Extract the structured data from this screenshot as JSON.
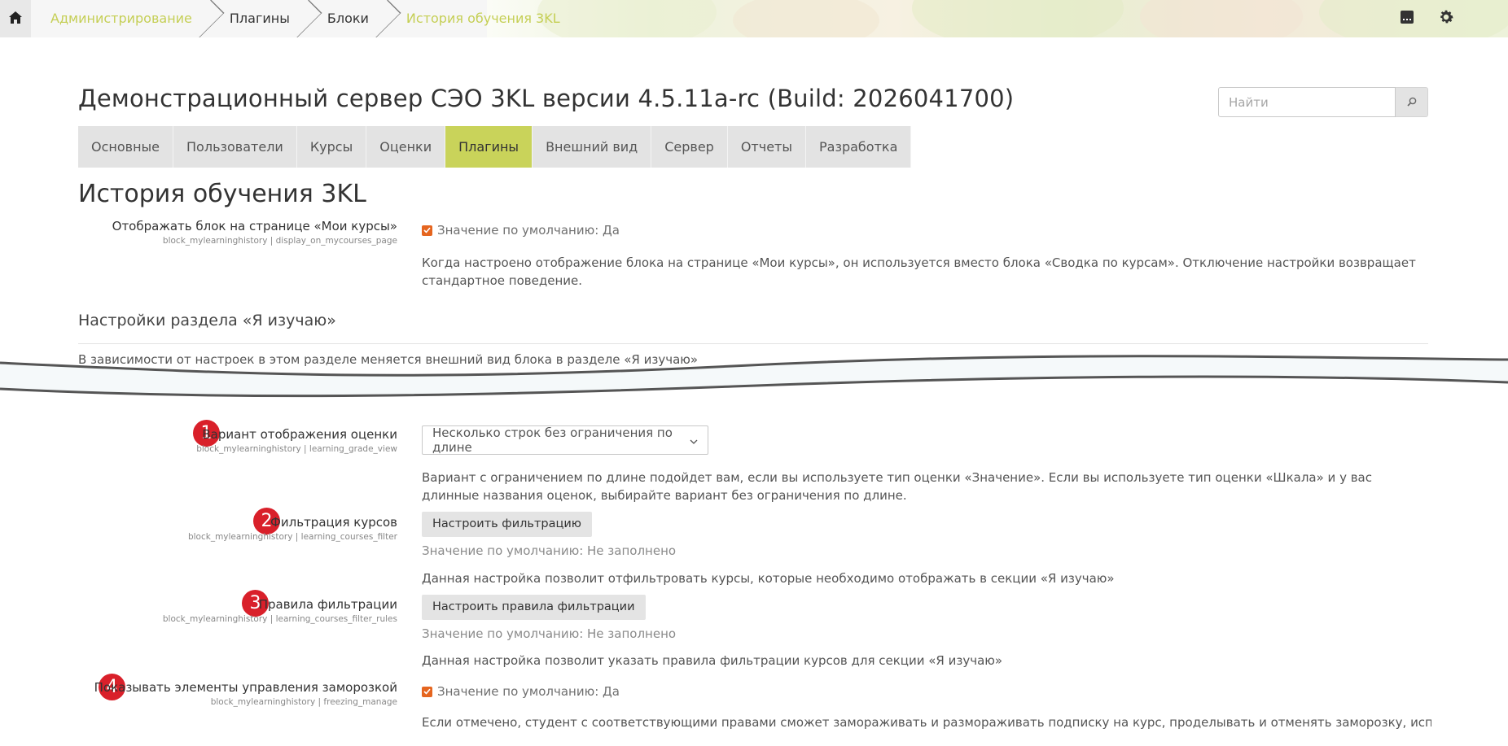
{
  "breadcrumbs": [
    {
      "label": "Администрирование",
      "link": true
    },
    {
      "label": "Плагины",
      "link": false
    },
    {
      "label": "Блоки",
      "link": false
    },
    {
      "label": "История обучения 3KL",
      "link": true
    }
  ],
  "icons": {
    "home": "home-icon",
    "notes": "notes-icon",
    "settings": "gear-icon",
    "search": "search-icon",
    "dropdown": "chevron-down-icon",
    "checkbox": "checkmark-icon"
  },
  "header": {
    "site_title": "Демонстрационный сервер СЭО 3KL версии 4.5.11a-rc (Build: 2026041700)",
    "search_placeholder": "Найти"
  },
  "tabs": [
    {
      "label": "Основные",
      "active": false
    },
    {
      "label": "Пользователи",
      "active": false
    },
    {
      "label": "Курсы",
      "active": false
    },
    {
      "label": "Оценки",
      "active": false
    },
    {
      "label": "Плагины",
      "active": true
    },
    {
      "label": "Внешний вид",
      "active": false
    },
    {
      "label": "Сервер",
      "active": false
    },
    {
      "label": "Отчеты",
      "active": false
    },
    {
      "label": "Разработка",
      "active": false
    }
  ],
  "page_heading": "История обучения 3KL",
  "settings": {
    "mycourses": {
      "name": "Отображать блок на странице «Мои курсы»",
      "key": "block_mylearninghistory | display_on_mycourses_page",
      "default": "Значение по умолчанию: Да",
      "checked": true,
      "description": "Когда настроено отображение блока на странице «Мои курсы», он используется вместо блока «Сводка по курсам». Отключение настройки возвращает стандартное поведение."
    },
    "section": {
      "title": "Настройки раздела «Я изучаю»",
      "description": "В зависимости от настроек в этом разделе меняется внешний вид блока в разделе «Я изучаю»"
    },
    "grade_view": {
      "marker": "1",
      "name": "Вариант отображения оценки",
      "key": "block_mylearninghistory | learning_grade_view",
      "selected": "Несколько строк без ограничения по длине",
      "description": "Вариант с ограничением по длине подойдет вам, если вы используете тип оценки «Значение». Если вы используете тип оценки «Шкала» и у вас длинные названия оценок, выбирайте вариант без ограничения по длине."
    },
    "courses_filter": {
      "marker": "2",
      "name": "Фильтрация курсов",
      "key": "block_mylearninghistory | learning_courses_filter",
      "button": "Настроить фильтрацию",
      "default": "Значение по умолчанию: Не заполнено",
      "description": "Данная настройка позволит отфильтровать курсы, которые необходимо отображать в секции «Я изучаю»"
    },
    "filter_rules": {
      "marker": "3",
      "name": "Правила фильтрации",
      "key": "block_mylearninghistory | learning_courses_filter_rules",
      "button": "Настроить правила фильтрации",
      "default": "Значение по умолчанию: Не заполнено",
      "description": "Данная настройка позволит указать правила фильтрации курсов для секции «Я изучаю»"
    },
    "freezing": {
      "marker": "4",
      "name": "Показывать элементы управления заморозкой",
      "key": "block_mylearninghistory | freezing_manage",
      "default": "Значение по умолчанию: Да",
      "checked": true,
      "description": "Если отмечено, студент с соответствующими правами сможет замораживать и размораживать подписку на курс, проделывать и отменять заморозку, используя ссылки в блоке"
    }
  },
  "colors": {
    "accent": "#c9d35a",
    "link": "#c5cf55",
    "checkbox": "#e5651f",
    "marker": "#d9202a"
  }
}
